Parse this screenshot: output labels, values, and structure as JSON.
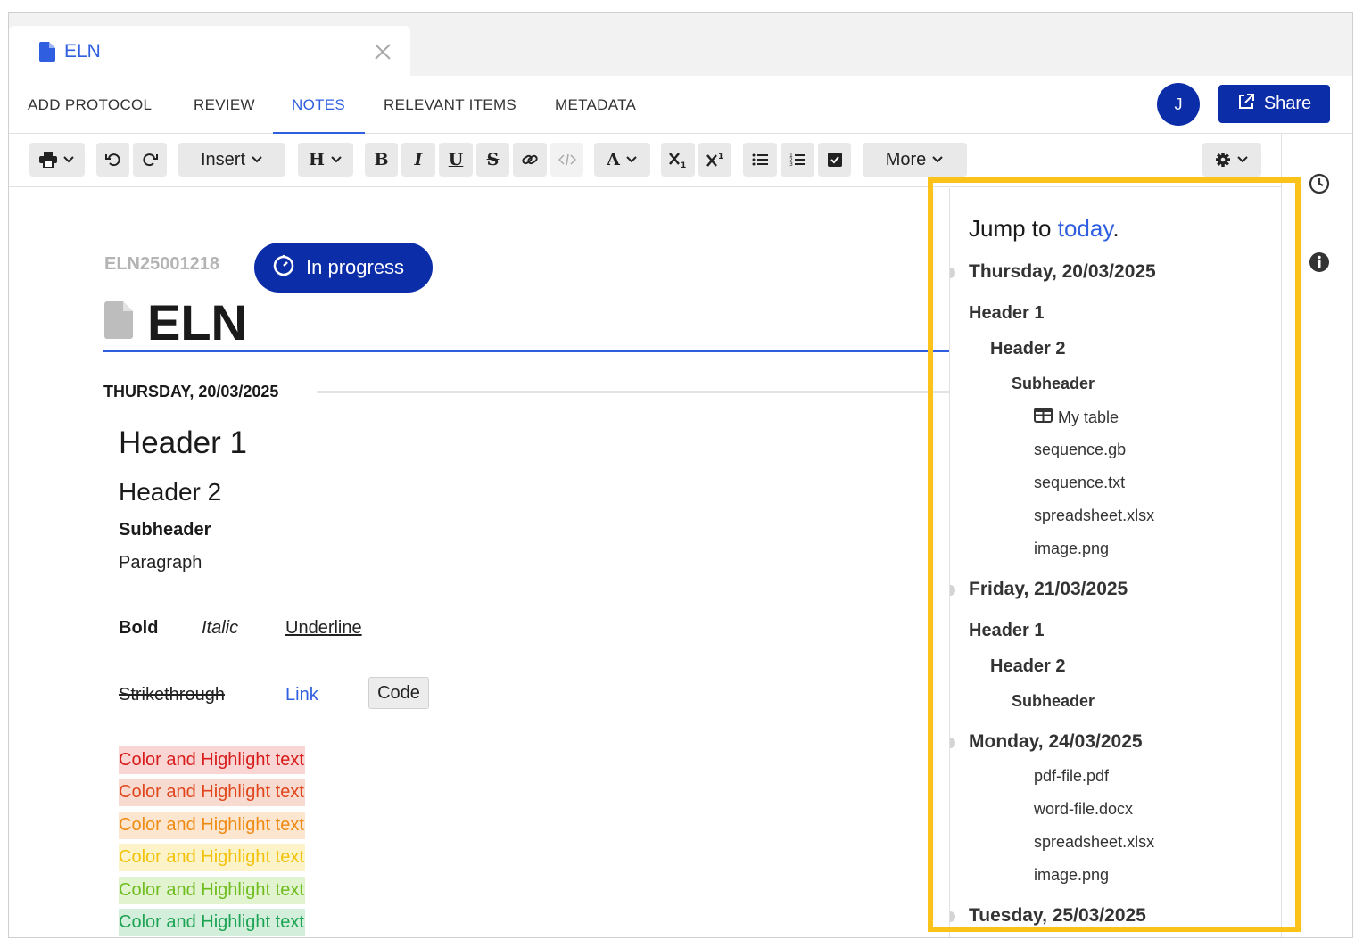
{
  "doc_tab": {
    "title": "ELN",
    "icon": "document-icon",
    "close_icon": "close-icon"
  },
  "nav": {
    "tabs": [
      {
        "label": "ADD PROTOCOL"
      },
      {
        "label": "REVIEW"
      },
      {
        "label": "NOTES",
        "active": true
      },
      {
        "label": "RELEVANT ITEMS"
      },
      {
        "label": "METADATA"
      }
    ],
    "avatar_initial": "J",
    "share_label": "Share"
  },
  "toolbar": {
    "insert_label": "Insert",
    "heading_label": "H",
    "bold_label": "B",
    "italic_label": "I",
    "underline_label": "U",
    "strike_label": "S",
    "font_color_label": "A",
    "more_label": "More"
  },
  "document": {
    "id": "ELN25001218",
    "status": "In progress",
    "title": "ELN",
    "date": "THURSDAY, 20/03/2025",
    "header1": "Header 1",
    "header2": "Header 2",
    "subheader": "Subheader",
    "paragraph": "Paragraph",
    "bold": "Bold",
    "italic": "Italic",
    "underline": "Underline",
    "strikethrough": "Strikethrough",
    "link": "Link",
    "code": "Code",
    "highlight_lines": [
      {
        "text": "Color and Highlight text",
        "color": "#d81b1b",
        "bg": "#f9d6d4"
      },
      {
        "text": "Color and Highlight text",
        "color": "#e0451c",
        "bg": "#f8dbd0"
      },
      {
        "text": "Color and Highlight text",
        "color": "#ef8a12",
        "bg": "#fde6cf"
      },
      {
        "text": "Color and Highlight text",
        "color": "#f2c20a",
        "bg": "#fdf3c9"
      },
      {
        "text": "Color and Highlight text",
        "color": "#6ebc1e",
        "bg": "#e2f3cf"
      },
      {
        "text": "Color and Highlight text",
        "color": "#1da354",
        "bg": "#d3efdb"
      }
    ]
  },
  "jump_panel": {
    "heading_prefix": "Jump to",
    "today_link": "today",
    "heading_suffix": ".",
    "days": [
      {
        "date": "Thursday, 20/03/2025",
        "header1": "Header 1",
        "header2": "Header 2",
        "subheader": "Subheader",
        "items": [
          "My table",
          "sequence.gb",
          "sequence.txt",
          "spreadsheet.xlsx",
          "image.png"
        ]
      },
      {
        "date": "Friday, 21/03/2025",
        "header1": "Header 1",
        "header2": "Header 2",
        "subheader": "Subheader"
      },
      {
        "date": "Monday, 24/03/2025",
        "items": [
          "pdf-file.pdf",
          "word-file.docx",
          "spreadsheet.xlsx",
          "image.png"
        ]
      },
      {
        "date": "Tuesday, 25/03/2025"
      }
    ]
  },
  "highlight_color": "#fbc21a",
  "accent_color": "#2f5fe0",
  "brand_color": "#0c2da8"
}
